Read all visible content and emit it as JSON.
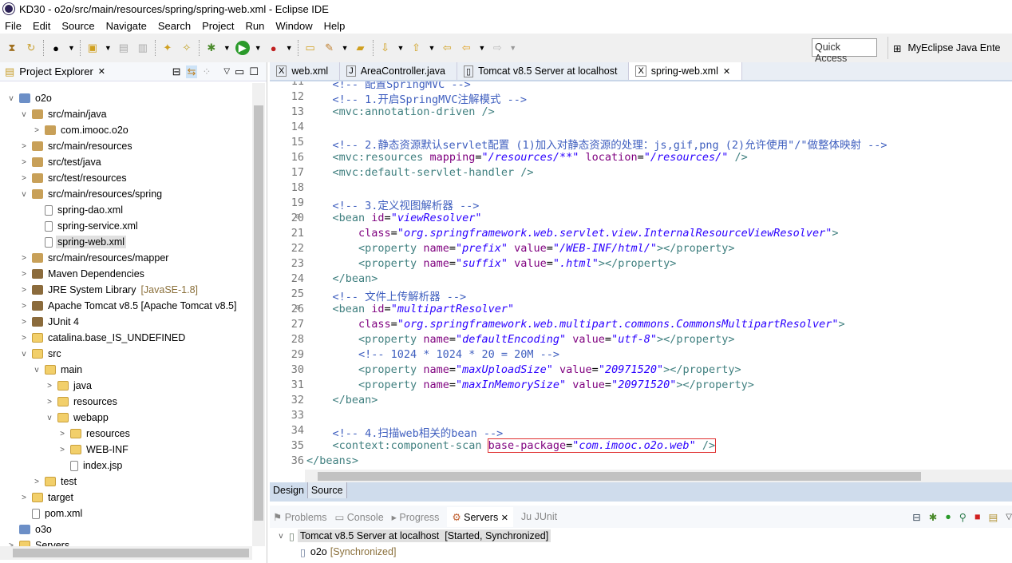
{
  "window": {
    "title": "KD30 - o2o/src/main/resources/spring/spring-web.xml - Eclipse IDE"
  },
  "menu": [
    "File",
    "Edit",
    "Source",
    "Navigate",
    "Search",
    "Project",
    "Run",
    "Window",
    "Help"
  ],
  "toolbar": {
    "quick_access": "Quick Access",
    "perspective": "MyEclipse Java Ente"
  },
  "explorer": {
    "title": "Project Explorer",
    "items": [
      {
        "label": "o2o",
        "depth": 0,
        "tw": "v",
        "icon": "proj"
      },
      {
        "label": "src/main/java",
        "depth": 1,
        "tw": "v",
        "icon": "pkg"
      },
      {
        "label": "com.imooc.o2o",
        "depth": 2,
        "tw": ">",
        "icon": "pkg"
      },
      {
        "label": "src/main/resources",
        "depth": 1,
        "tw": ">",
        "icon": "pkg"
      },
      {
        "label": "src/test/java",
        "depth": 1,
        "tw": ">",
        "icon": "pkg"
      },
      {
        "label": "src/test/resources",
        "depth": 1,
        "tw": ">",
        "icon": "pkg"
      },
      {
        "label": "src/main/resources/spring",
        "depth": 1,
        "tw": "v",
        "icon": "pkg"
      },
      {
        "label": "spring-dao.xml",
        "depth": 2,
        "tw": "",
        "icon": "file"
      },
      {
        "label": "spring-service.xml",
        "depth": 2,
        "tw": "",
        "icon": "file"
      },
      {
        "label": "spring-web.xml",
        "depth": 2,
        "tw": "",
        "icon": "file",
        "selected": true
      },
      {
        "label": "src/main/resources/mapper",
        "depth": 1,
        "tw": ">",
        "icon": "pkg"
      },
      {
        "label": "Maven Dependencies",
        "depth": 1,
        "tw": ">",
        "icon": "lib"
      },
      {
        "label": "JRE System Library",
        "dec": "[JavaSE-1.8]",
        "depth": 1,
        "tw": ">",
        "icon": "lib"
      },
      {
        "label": "Apache Tomcat v8.5 [Apache Tomcat v8.5]",
        "depth": 1,
        "tw": ">",
        "icon": "lib"
      },
      {
        "label": "JUnit 4",
        "depth": 1,
        "tw": ">",
        "icon": "lib"
      },
      {
        "label": "catalina.base_IS_UNDEFINED",
        "depth": 1,
        "tw": ">",
        "icon": "folder"
      },
      {
        "label": "src",
        "depth": 1,
        "tw": "v",
        "icon": "folder"
      },
      {
        "label": "main",
        "depth": 2,
        "tw": "v",
        "icon": "folder"
      },
      {
        "label": "java",
        "depth": 3,
        "tw": ">",
        "icon": "folder"
      },
      {
        "label": "resources",
        "depth": 3,
        "tw": ">",
        "icon": "folder"
      },
      {
        "label": "webapp",
        "depth": 3,
        "tw": "v",
        "icon": "folder"
      },
      {
        "label": "resources",
        "depth": 4,
        "tw": ">",
        "icon": "folder"
      },
      {
        "label": "WEB-INF",
        "depth": 4,
        "tw": ">",
        "icon": "folder"
      },
      {
        "label": "index.jsp",
        "depth": 4,
        "tw": "",
        "icon": "file"
      },
      {
        "label": "test",
        "depth": 2,
        "tw": ">",
        "icon": "folder"
      },
      {
        "label": "target",
        "depth": 1,
        "tw": ">",
        "icon": "folder"
      },
      {
        "label": "pom.xml",
        "depth": 1,
        "tw": "",
        "icon": "file"
      },
      {
        "label": "o3o",
        "depth": 0,
        "tw": "",
        "icon": "proj"
      },
      {
        "label": "Servers",
        "depth": 0,
        "tw": ">",
        "icon": "folder"
      }
    ]
  },
  "editor": {
    "tabs": [
      {
        "label": "web.xml",
        "icon": "X"
      },
      {
        "label": "AreaController.java",
        "icon": "J"
      },
      {
        "label": "Tomcat v8.5 Server at localhost",
        "icon": "▯"
      },
      {
        "label": "spring-web.xml",
        "icon": "X",
        "active": true
      }
    ],
    "lines": [
      {
        "n": "11",
        "t": [
          [
            "com",
            "    <!-- 配置SpringMVC -->"
          ]
        ]
      },
      {
        "n": "12",
        "t": [
          [
            "com",
            "    <!-- 1.开启SpringMVC注解模式 -->"
          ]
        ]
      },
      {
        "n": "13",
        "t": [
          [
            "tag",
            "    <mvc:annotation-driven />"
          ]
        ]
      },
      {
        "n": "14",
        "t": []
      },
      {
        "n": "15",
        "t": [
          [
            "com",
            "    <!-- 2.静态资源默认servlet配置 (1)加入对静态资源的处理：js,gif,png (2)允许使用\"/\"做整体映射 -->"
          ]
        ]
      },
      {
        "n": "16",
        "t": [
          [
            "tag",
            "    <mvc:resources "
          ],
          [
            "attr",
            "mapping"
          ],
          [
            "txt",
            "="
          ],
          [
            "str",
            "\"/resources/**\""
          ],
          [
            "txt",
            " "
          ],
          [
            "attr",
            "location"
          ],
          [
            "txt",
            "="
          ],
          [
            "str",
            "\"/resources/\""
          ],
          [
            "tag",
            " />"
          ]
        ]
      },
      {
        "n": "17",
        "t": [
          [
            "tag",
            "    <mvc:default-servlet-handler />"
          ]
        ]
      },
      {
        "n": "18",
        "t": []
      },
      {
        "n": "19",
        "t": [
          [
            "com",
            "    <!-- 3.定义视图解析器 -->"
          ]
        ]
      },
      {
        "n": "20",
        "fold": true,
        "t": [
          [
            "tag",
            "    <bean "
          ],
          [
            "attr",
            "id"
          ],
          [
            "txt",
            "="
          ],
          [
            "str",
            "\"viewResolver\""
          ]
        ]
      },
      {
        "n": "21",
        "t": [
          [
            "attr",
            "        class"
          ],
          [
            "txt",
            "="
          ],
          [
            "str",
            "\"org.springframework.web.servlet.view.InternalResourceViewResolver\""
          ],
          [
            "tag",
            ">"
          ]
        ]
      },
      {
        "n": "22",
        "t": [
          [
            "tag",
            "        <property "
          ],
          [
            "attr",
            "name"
          ],
          [
            "txt",
            "="
          ],
          [
            "str",
            "\"prefix\""
          ],
          [
            "txt",
            " "
          ],
          [
            "attr",
            "value"
          ],
          [
            "txt",
            "="
          ],
          [
            "str",
            "\"/WEB-INF/html/\""
          ],
          [
            "tag",
            "></property>"
          ]
        ]
      },
      {
        "n": "23",
        "t": [
          [
            "tag",
            "        <property "
          ],
          [
            "attr",
            "name"
          ],
          [
            "txt",
            "="
          ],
          [
            "str",
            "\"suffix\""
          ],
          [
            "txt",
            " "
          ],
          [
            "attr",
            "value"
          ],
          [
            "txt",
            "="
          ],
          [
            "str",
            "\".html\""
          ],
          [
            "tag",
            "></property>"
          ]
        ]
      },
      {
        "n": "24",
        "t": [
          [
            "tag",
            "    </bean>"
          ]
        ]
      },
      {
        "n": "25",
        "t": [
          [
            "com",
            "    <!-- 文件上传解析器 -->"
          ]
        ]
      },
      {
        "n": "26",
        "fold": true,
        "t": [
          [
            "tag",
            "    <bean "
          ],
          [
            "attr",
            "id"
          ],
          [
            "txt",
            "="
          ],
          [
            "str",
            "\"multipartResolver\""
          ]
        ]
      },
      {
        "n": "27",
        "t": [
          [
            "attr",
            "        class"
          ],
          [
            "txt",
            "="
          ],
          [
            "str",
            "\"org.springframework.web.multipart.commons.CommonsMultipartResolver\""
          ],
          [
            "tag",
            ">"
          ]
        ]
      },
      {
        "n": "28",
        "t": [
          [
            "tag",
            "        <property "
          ],
          [
            "attr",
            "name"
          ],
          [
            "txt",
            "="
          ],
          [
            "str",
            "\"defaultEncoding\""
          ],
          [
            "txt",
            " "
          ],
          [
            "attr",
            "value"
          ],
          [
            "txt",
            "="
          ],
          [
            "str",
            "\"utf-8\""
          ],
          [
            "tag",
            "></property>"
          ]
        ]
      },
      {
        "n": "29",
        "t": [
          [
            "com",
            "        <!-- 1024 * 1024 * 20 = 20M -->"
          ]
        ]
      },
      {
        "n": "30",
        "t": [
          [
            "tag",
            "        <property "
          ],
          [
            "attr",
            "name"
          ],
          [
            "txt",
            "="
          ],
          [
            "str",
            "\"maxUploadSize\""
          ],
          [
            "txt",
            " "
          ],
          [
            "attr",
            "value"
          ],
          [
            "txt",
            "="
          ],
          [
            "str",
            "\"20971520\""
          ],
          [
            "tag",
            "></property>"
          ]
        ]
      },
      {
        "n": "31",
        "t": [
          [
            "tag",
            "        <property "
          ],
          [
            "attr",
            "name"
          ],
          [
            "txt",
            "="
          ],
          [
            "str",
            "\"maxInMemorySize\""
          ],
          [
            "txt",
            " "
          ],
          [
            "attr",
            "value"
          ],
          [
            "txt",
            "="
          ],
          [
            "str",
            "\"20971520\""
          ],
          [
            "tag",
            "></property>"
          ]
        ]
      },
      {
        "n": "32",
        "t": [
          [
            "tag",
            "    </bean>"
          ]
        ]
      },
      {
        "n": "33",
        "t": []
      },
      {
        "n": "34",
        "t": [
          [
            "com",
            "    <!-- 4.扫描web相关的bean -->"
          ]
        ]
      },
      {
        "n": "35",
        "t": [
          [
            "tag",
            "    <context:component-scan "
          ],
          [
            "box",
            ""
          ],
          [
            "attr",
            "base-package"
          ],
          [
            "txt",
            "="
          ],
          [
            "str",
            "\"com.imooc.o2o.web\""
          ],
          [
            "tag",
            " />"
          ]
        ]
      },
      {
        "n": "36",
        "t": [
          [
            "tag",
            "</beans>"
          ]
        ]
      }
    ],
    "bottom_tabs": [
      "Design",
      "Source"
    ]
  },
  "servers": {
    "tabs": [
      "Problems",
      "Console",
      "Progress",
      "Servers",
      "JUnit"
    ],
    "active": "Servers",
    "server": {
      "name": "Tomcat v8.5 Server at localhost",
      "status": "[Started, Synchronized]"
    },
    "module": {
      "name": "o2o",
      "status": "[Synchronized]"
    }
  },
  "colors": {
    "tag": "#3f7f7f",
    "attr": "#7f007f",
    "string": "#2a00ff",
    "comment": "#3f5fbf"
  }
}
